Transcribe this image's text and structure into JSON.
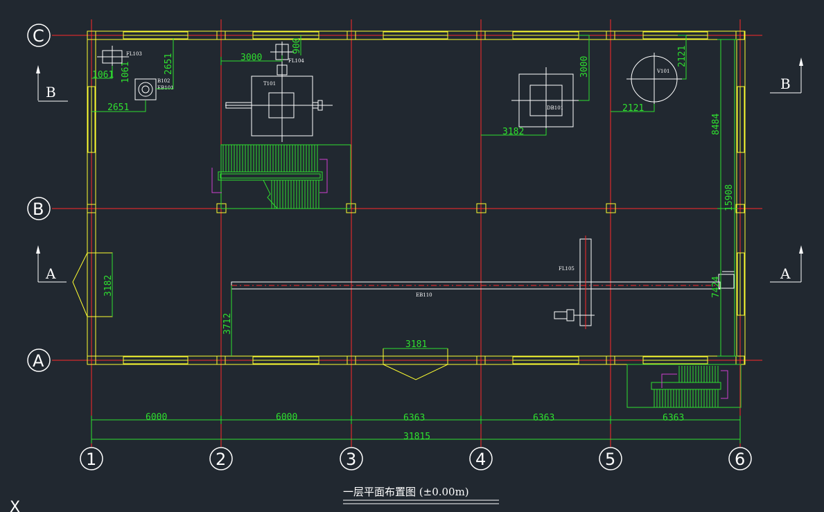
{
  "drawing": {
    "title": "一层平面布置图 (±0.00m)",
    "row_axes": [
      "C",
      "B",
      "A"
    ],
    "col_axes": [
      "1",
      "2",
      "3",
      "4",
      "5",
      "6"
    ],
    "section_marks": {
      "left_top": "B",
      "right_top": "B",
      "left_bottom": "A",
      "right_bottom": "A"
    },
    "cursor_glyph": "X"
  },
  "dimensions": {
    "spans": [
      "6000",
      "6000",
      "6363",
      "6363",
      "6363"
    ],
    "total": "31815",
    "d_1061_h": "1061",
    "d_1061_v": "1061",
    "d_2651_v": "2651",
    "d_2651_h": "2651",
    "d_3000_h": "3000",
    "d_900": "900",
    "d_3000_v": "3000",
    "d_3182_h": "3182",
    "d_2121_v": "2121",
    "d_2121_h": "2121",
    "d_8484": "8484",
    "d_15908": "15908",
    "d_7424": "7424",
    "d_3182_v": "3182",
    "d_3712": "3712",
    "d_3181": "3181"
  },
  "equipment": {
    "fl103": "FL103",
    "fl104": "FL104",
    "b102": "B102",
    "eb101_small": "EB101",
    "t101": "T101",
    "db101": "DB101",
    "v101": "V101",
    "fl105": "FL105",
    "eb110": "EB110"
  }
}
